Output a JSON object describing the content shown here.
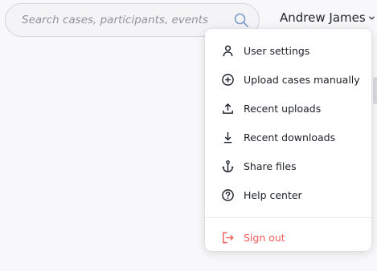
{
  "search": {
    "placeholder": "Search cases, participants, events",
    "icon": "search-icon"
  },
  "user": {
    "name": "Andrew James",
    "icon": "chevron-down-icon"
  },
  "menu": {
    "items": [
      {
        "label": "User settings",
        "icon": "user-icon"
      },
      {
        "label": "Upload cases manually",
        "icon": "plus-circle-icon"
      },
      {
        "label": "Recent uploads",
        "icon": "upload-icon"
      },
      {
        "label": "Recent downloads",
        "icon": "download-icon"
      },
      {
        "label": "Share files",
        "icon": "anchor-icon"
      },
      {
        "label": "Help center",
        "icon": "help-circle-icon"
      }
    ],
    "sign_out": {
      "label": "Sign out",
      "icon": "logout-icon",
      "color": "#ec5a5a"
    }
  },
  "colors": {
    "background": "#f8f8fa",
    "search_border": "#d3d5dc",
    "search_icon": "#7a9cc6",
    "text": "#1c1f26"
  }
}
